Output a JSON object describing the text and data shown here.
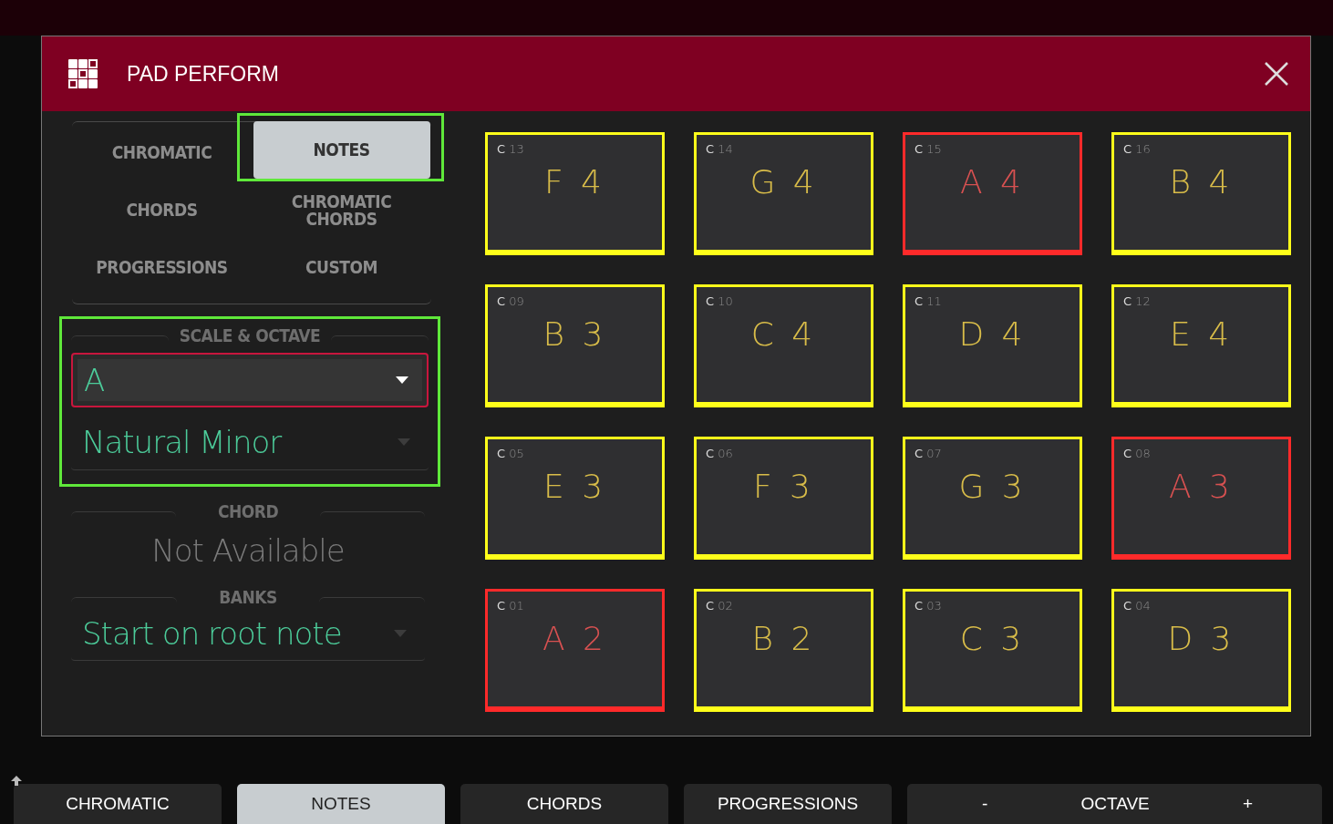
{
  "dialog": {
    "title": "PAD PERFORM"
  },
  "modes": [
    {
      "label": "CHROMATIC",
      "selected": false,
      "highlighted": false
    },
    {
      "label": "NOTES",
      "selected": true,
      "highlighted": true
    },
    {
      "label": "CHORDS",
      "selected": false,
      "highlighted": false
    },
    {
      "label": "CHROMATIC CHORDS",
      "selected": false,
      "highlighted": false
    },
    {
      "label": "PROGRESSIONS",
      "selected": false,
      "highlighted": false
    },
    {
      "label": "CUSTOM",
      "selected": false,
      "highlighted": false
    }
  ],
  "scale_octave": {
    "heading": "SCALE & OCTAVE",
    "highlighted": true,
    "root": {
      "value": "A",
      "focused": true
    },
    "scale": {
      "value": "Natural Minor",
      "focused": false
    }
  },
  "chord": {
    "heading": "CHORD",
    "value": "Not Available"
  },
  "banks": {
    "heading": "BANKS",
    "value": "Start on root note",
    "focused": false
  },
  "pads": [
    {
      "label": "**C** 13",
      "note": "F 4",
      "color": "#ffff1a"
    },
    {
      "label": "**C** 14",
      "note": "G 4",
      "color": "#ffff1a"
    },
    {
      "label": "**C** 15",
      "note": "A 4",
      "color": "#ff2a2a"
    },
    {
      "label": "**C** 16",
      "note": "B 4",
      "color": "#ffff1a"
    },
    {
      "label": "**C** 09",
      "note": "B 3",
      "color": "#ffff1a"
    },
    {
      "label": "**C** 10",
      "note": "C 4",
      "color": "#ffff1a"
    },
    {
      "label": "**C** 11",
      "note": "D 4",
      "color": "#ffff1a"
    },
    {
      "label": "**C** 12",
      "note": "E 4",
      "color": "#ffff1a"
    },
    {
      "label": "**C** 05",
      "note": "E 3",
      "color": "#ffff1a"
    },
    {
      "label": "**C** 06",
      "note": "F 3",
      "color": "#ffff1a"
    },
    {
      "label": "**C** 07",
      "note": "G 3",
      "color": "#ffff1a"
    },
    {
      "label": "**C** 08",
      "note": "A 3",
      "color": "#ff2a2a"
    },
    {
      "label": "**C** 01",
      "note": "A 2",
      "color": "#ff2a2a"
    },
    {
      "label": "**C** 02",
      "note": "B 2",
      "color": "#ffff1a"
    },
    {
      "label": "**C** 03",
      "note": "C 3",
      "color": "#ffff1a"
    },
    {
      "label": "**C** 04",
      "note": "D 3",
      "color": "#ffff1a"
    }
  ],
  "bottom_bar": [
    {
      "kind": "tab",
      "label": "CHROMATIC",
      "selected": false
    },
    {
      "kind": "tab",
      "label": "NOTES",
      "selected": true
    },
    {
      "kind": "tab",
      "label": "CHORDS",
      "selected": false
    },
    {
      "kind": "tab",
      "label": "PROGRESSIONS",
      "selected": false
    },
    {
      "kind": "stepper",
      "label": "OCTAVE",
      "minus": "-",
      "plus": "+"
    }
  ]
}
